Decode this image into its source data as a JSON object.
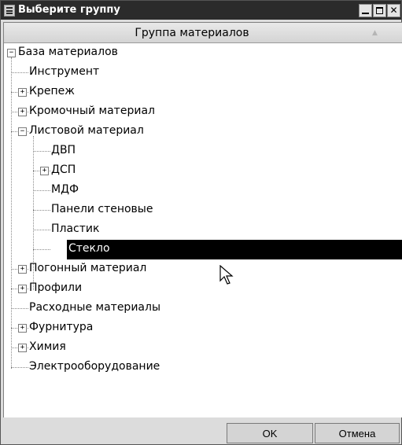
{
  "window": {
    "title": "Выберите группу",
    "controls": {
      "minimize": "_",
      "maximize": "□",
      "close": "x"
    }
  },
  "column_header": {
    "label": "Группа материалов",
    "sort_icon": "sort-ascending-icon"
  },
  "tree": {
    "nodes": [
      {
        "label": "База материалов",
        "expander": "−"
      },
      {
        "label": "Инструмент"
      },
      {
        "label": "Крепеж",
        "expander": "+"
      },
      {
        "label": "Кромочный материал",
        "expander": "+"
      },
      {
        "label": "Листовой материал",
        "expander": "−"
      },
      {
        "label": "ДВП"
      },
      {
        "label": "ДСП",
        "expander": "+"
      },
      {
        "label": "МДФ"
      },
      {
        "label": "Панели стеновые"
      },
      {
        "label": "Пластик"
      },
      {
        "label": "Стекло",
        "selected": true
      },
      {
        "label": "Погонный материал",
        "expander": "+"
      },
      {
        "label": "Профили",
        "expander": "+"
      },
      {
        "label": "Расходные материалы"
      },
      {
        "label": "Фурнитура",
        "expander": "+"
      },
      {
        "label": "Химия",
        "expander": "+"
      },
      {
        "label": "Электрооборудование"
      }
    ]
  },
  "buttons": {
    "ok": "OK",
    "cancel": "Отмена"
  },
  "colors": {
    "titlebar": "#2b2b2b",
    "selection": "#000000",
    "background": "#dcdcdc"
  }
}
